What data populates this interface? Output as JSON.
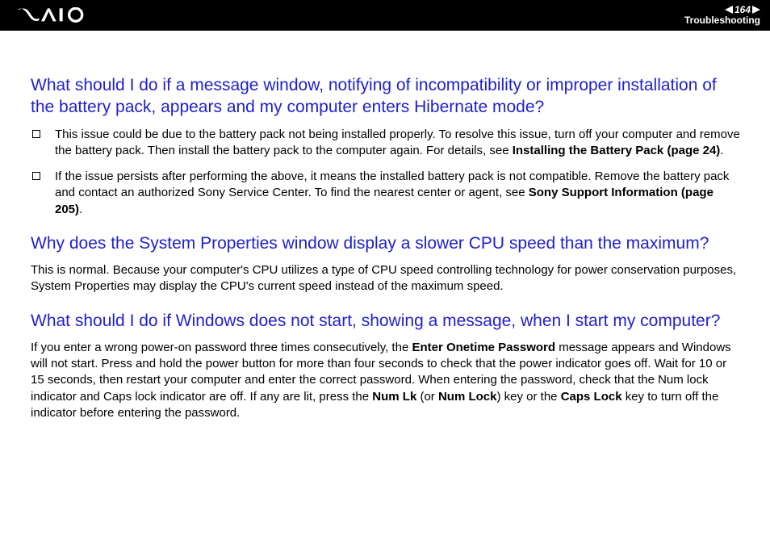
{
  "header": {
    "page_number": "164",
    "section": "Troubleshooting"
  },
  "q1": {
    "heading": "What should I do if a message window, notifying of incompatibility or improper installation of the battery pack, appears and my computer enters Hibernate mode?",
    "bullets": [
      {
        "t1": "This issue could be due to the battery pack not being installed properly. To resolve this issue, turn off your computer and remove the battery pack. Then install the battery pack to the computer again. For details, see ",
        "b1": "Installing the Battery Pack (page 24)",
        "t2": "."
      },
      {
        "t1": "If the issue persists after performing the above, it means the installed battery pack is not compatible. Remove the battery pack and contact an authorized Sony Service Center. To find the nearest center or agent, see ",
        "b1": "Sony Support Information (page 205)",
        "t2": "."
      }
    ]
  },
  "q2": {
    "heading": "Why does the System Properties window display a slower CPU speed than the maximum?",
    "para": "This is normal. Because your computer's CPU utilizes a type of CPU speed controlling technology for power conservation purposes, System Properties may display the CPU's current speed instead of the maximum speed."
  },
  "q3": {
    "heading": "What should I do if Windows does not start, showing a message, when I start my computer?",
    "para_parts": {
      "t1": "If you enter a wrong power-on password three times consecutively, the ",
      "b1": "Enter Onetime Password",
      "t2": " message appears and Windows will not start. Press and hold the power button for more than four seconds to check that the power indicator goes off. Wait for 10 or 15 seconds, then restart your computer and enter the correct password. When entering the password, check that the Num lock indicator and Caps lock indicator are off. If any are lit, press the ",
      "b2": "Num Lk",
      "t3": " (or ",
      "b3": "Num Lock",
      "t4": ") key or the ",
      "b4": "Caps Lock",
      "t5": " key to turn off the indicator before entering the password."
    }
  }
}
